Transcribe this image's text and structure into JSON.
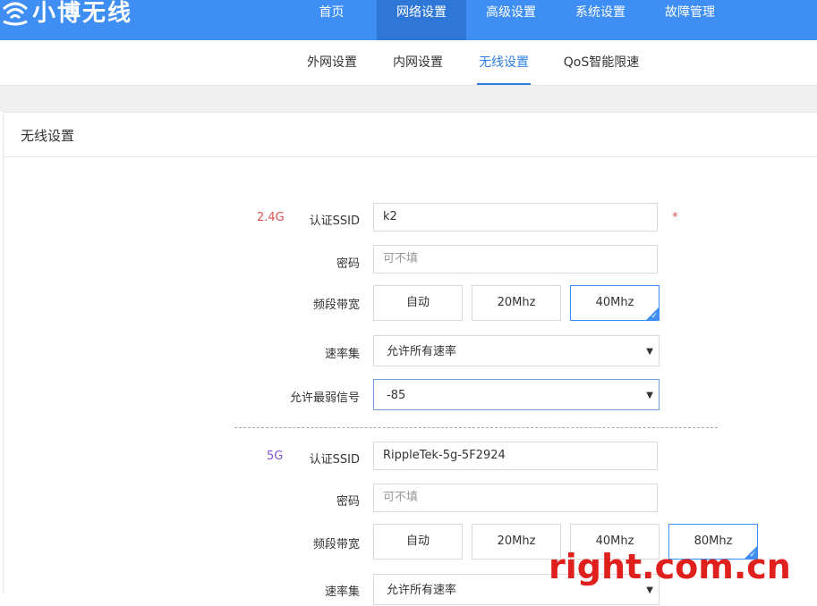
{
  "brand": {
    "name": "小博无线"
  },
  "nav": {
    "items": [
      {
        "label": "首页"
      },
      {
        "label": "网络设置"
      },
      {
        "label": "高级设置"
      },
      {
        "label": "系统设置"
      },
      {
        "label": "故障管理"
      }
    ],
    "active": "网络设置"
  },
  "subnav": {
    "items": [
      {
        "label": "外网设置"
      },
      {
        "label": "内网设置"
      },
      {
        "label": "无线设置"
      },
      {
        "label": "QoS智能限速"
      }
    ],
    "active": "无线设置"
  },
  "panel": {
    "title": "无线设置"
  },
  "wifi24": {
    "band": "2.4G",
    "ssid_label": "认证SSID",
    "ssid_value": "k2",
    "required_mark": "*",
    "password_label": "密码",
    "password_placeholder": "可不填",
    "bandwidth_label": "频段带宽",
    "bandwidth_options": [
      "自动",
      "20Mhz",
      "40Mhz"
    ],
    "bandwidth_selected": "40Mhz",
    "rate_label": "速率集",
    "rate_value": "允许所有速率",
    "signal_label": "允许最弱信号",
    "signal_value": "-85"
  },
  "wifi5": {
    "band": "5G",
    "ssid_label": "认证SSID",
    "ssid_value": "RippleTek-5g-5F2924",
    "password_label": "密码",
    "password_placeholder": "可不填",
    "bandwidth_label": "频段带宽",
    "bandwidth_options": [
      "自动",
      "20Mhz",
      "40Mhz",
      "80Mhz"
    ],
    "bandwidth_selected": "80Mhz",
    "rate_label": "速率集",
    "rate_value": "允许所有速率"
  },
  "watermark": "right.com.cn",
  "colors": {
    "primary": "#3f8ef3",
    "nav_active": "#2f77d6",
    "required": "#d9534f",
    "band5": "#7b52c9"
  }
}
